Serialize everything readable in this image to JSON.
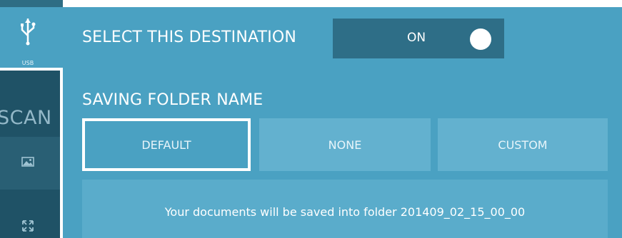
{
  "sidebar": {
    "usb_label": "USB",
    "scan_label": "SCAN",
    "icons": {
      "usb": "usb-icon",
      "photo": "photo-icon",
      "expand": "expand-icon"
    }
  },
  "destination": {
    "select_label": "SELECT THIS DESTINATION",
    "toggle_state": "ON"
  },
  "folder": {
    "heading": "SAVING FOLDER NAME",
    "options": [
      {
        "label": "DEFAULT",
        "selected": true
      },
      {
        "label": "NONE",
        "selected": false
      },
      {
        "label": "CUSTOM",
        "selected": false
      }
    ],
    "info_text": "Your documents will be saved into folder 201409_02_15_00_00"
  },
  "colors": {
    "panel": "#4aa1c2",
    "rail_dark": "#1f5266",
    "toggle_bg": "#2e6e87",
    "option_bg": "#63b1cf",
    "text": "#ffffff"
  }
}
